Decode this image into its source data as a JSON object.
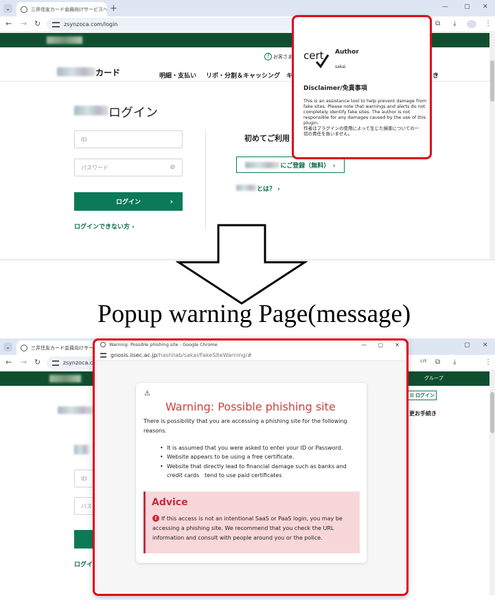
{
  "top": {
    "tab_title": "三井住友カード会員向けサービスへ",
    "url": "zsynzoca.com/login",
    "header_link": "お客さま",
    "brand_suffix": "カード",
    "nav": [
      "明細・支払い",
      "リボ・分割＆キャッシング",
      "キ"
    ],
    "nav_end": "き",
    "login_heading": "ログイン",
    "id_placeholder": "ID",
    "password_placeholder": "パスワード",
    "login_button": "ログイン",
    "forgot_link": "ログインできない方 ›",
    "first_time": "初めてご利用",
    "register_button": "にご登録（無料）　›",
    "what_is": "とは？ ›",
    "extension_popup": {
      "logo_text": "cert",
      "author_label": "Author",
      "author_name": "sakai",
      "disclaimer_heading": "Disclaimer/免責事項",
      "disclaimer_en_1": "This is an assistance tool to help prevent damage from",
      "disclaimer_en_2": "fake sites. Please note that warnings and alerts do not",
      "disclaimer_en_3": "completely identify fake sites. The author is not",
      "disclaimer_en_4": "responsible for any damages caused by the use of this",
      "disclaimer_en_5": "plugin.",
      "disclaimer_ja_1": "作者はプラグインの使用によって生じた損害についての一",
      "disclaimer_ja_2": "切の責任を負いません。"
    }
  },
  "caption": "Popup warning Page(message)",
  "bottom": {
    "tab_title": "三井住友カード会員向けサービスへ",
    "url": "zsynzoca.com",
    "group_label": "グループ",
    "login_btn": "ログイン",
    "procedures": "更お手続き",
    "id_placeholder": "ID",
    "password_placeholder": "パス",
    "forgot_fragment": "ログイ",
    "popup_window": {
      "title": "Warning: Possible phishing site - Google Chrome",
      "url_host": "gnosis.iisec.ac.jp",
      "url_path": "/hashilab/sakai/FakeSiteWarning/#",
      "warning_title": "Warning: Possible phishing site",
      "intro_1": "There is possibility that you are accessing a phishing site for the following",
      "intro_2": "reasons.",
      "reasons": [
        "It is assumed that you were asked to enter your ID or Password.",
        "Website appears to be using a free certificate.",
        "Website that directly lead to financial damage such as banks and",
        "credit cards　tend to use paid certificates"
      ],
      "advice_title": "Advice",
      "advice_1": "If this access is not an intentional SaaS or PaaS login, you may be",
      "advice_2": "accessing a phishing site. We recommend that you check the URL",
      "advice_3": "information and consult with people around you or the police."
    }
  },
  "colors": {
    "warning_red": "#d43c3c",
    "highlight_red": "#e0001b",
    "brand_green": "#0c7a57"
  }
}
